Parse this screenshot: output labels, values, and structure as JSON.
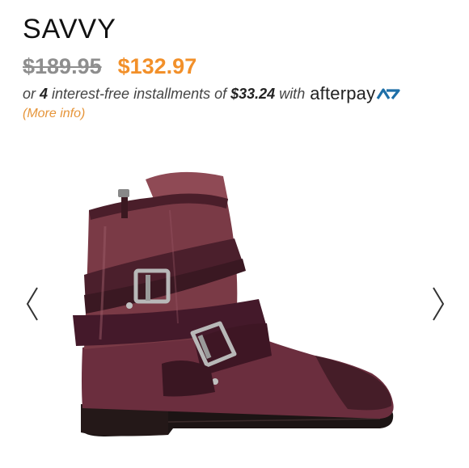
{
  "product": {
    "title": "SAVVY",
    "original_price": "$189.95",
    "sale_price": "$132.97"
  },
  "installments": {
    "prefix": "or ",
    "count": "4",
    "middle": " interest-free installments of ",
    "amount": "$33.24",
    "suffix": " with",
    "provider": "afterpay"
  },
  "more_info": {
    "label": "(More info)"
  },
  "gallery": {
    "prev_icon": "chevron-left-icon",
    "next_icon": "chevron-right-icon",
    "image_icon": "ankle-boot-image"
  },
  "colors": {
    "sale_price": "#f2902a",
    "more_info": "#e6953a",
    "strike_price": "#8e8e8e",
    "afterpay_mint": "#1e6fa8"
  }
}
